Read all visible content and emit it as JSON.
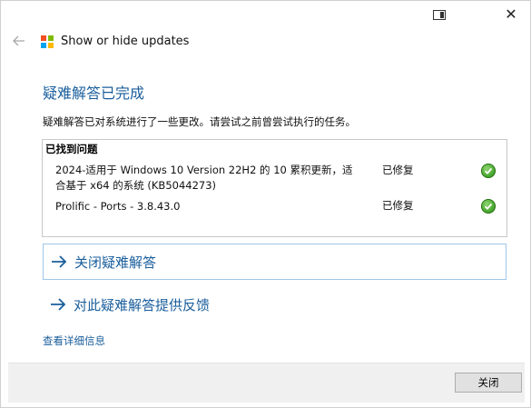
{
  "app": {
    "title": "Show or hide updates"
  },
  "main": {
    "heading": "疑难解答已完成",
    "description": "疑难解答已对系统进行了一些更改。请尝试之前曾尝试执行的任务。",
    "problems": {
      "title": "已找到问题",
      "items": [
        {
          "name_line1": "2024-适用于 Windows 10 Version 22H2 的 10 累积更新，适",
          "name_line2": "合基于 x64 的系统 (KB5044273)",
          "status": "已修复",
          "status_icon": "green-check-icon"
        },
        {
          "name_line1": "Prolific - Ports - 3.8.43.0",
          "name_line2": "",
          "status": "已修复",
          "status_icon": "green-check-icon"
        }
      ]
    },
    "actions": {
      "close_troubleshooter": "关闭疑难解答",
      "feedback": "对此疑难解答提供反馈"
    },
    "details_link": "查看详细信息"
  },
  "footer": {
    "close_button": "关闭"
  },
  "colors": {
    "accent": "#1a5e9c",
    "check_green": "#48a82f",
    "logo": [
      "#f25022",
      "#7fba00",
      "#00a4ef",
      "#ffb900"
    ]
  }
}
